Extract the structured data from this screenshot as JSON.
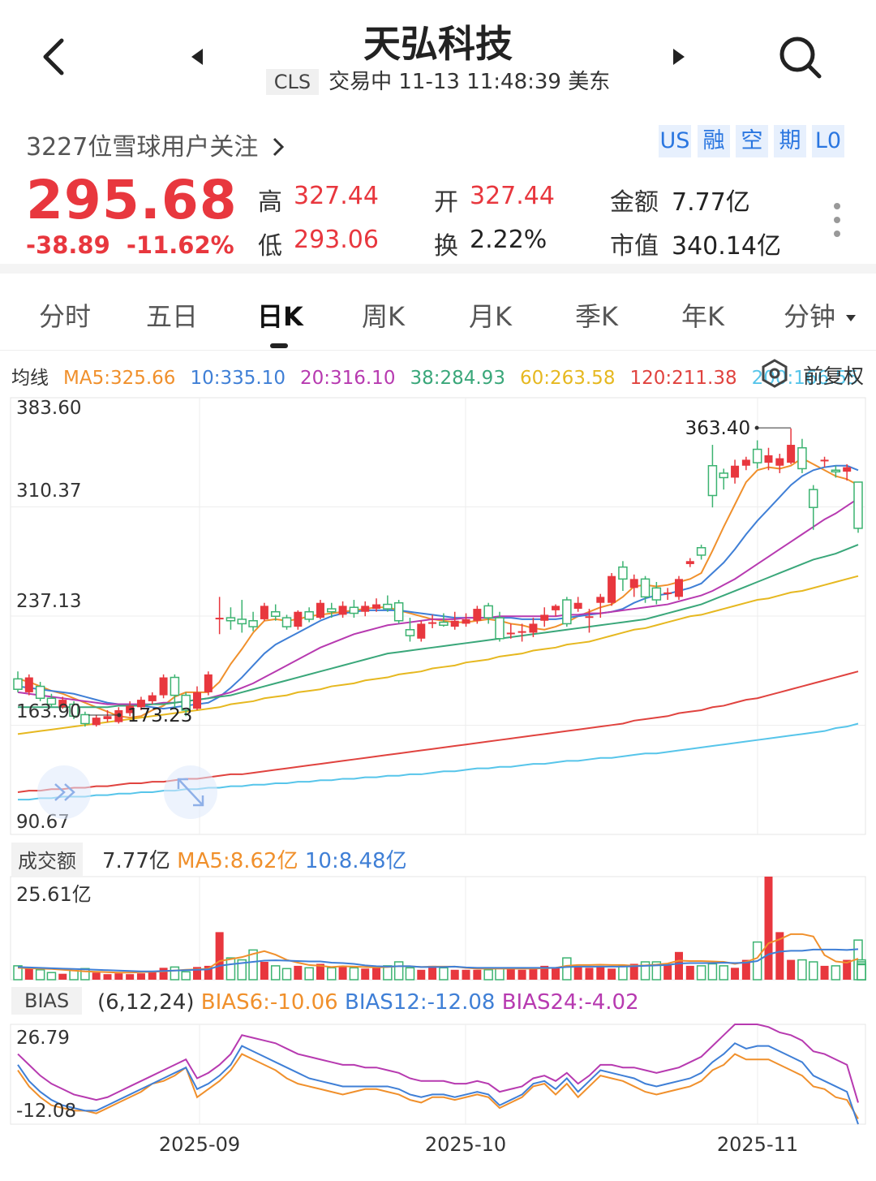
{
  "header": {
    "title": "天弘科技",
    "exchange_badge": "CLS",
    "status_text": "交易中 11-13 11:48:39 美东"
  },
  "info": {
    "followers": "3227位雪球用户关注",
    "flags": [
      "US",
      "融",
      "空",
      "期",
      "L0"
    ],
    "price": "295.68",
    "change": "-38.89",
    "change_pct": "-11.62%",
    "stats": {
      "high_label": "高",
      "high": "327.44",
      "low_label": "低",
      "low": "293.06",
      "open_label": "开",
      "open": "327.44",
      "turnover_label": "换",
      "turnover": "2.22%",
      "amount_label": "金额",
      "amount": "7.77亿",
      "mktcap_label": "市值",
      "mktcap": "340.14亿"
    }
  },
  "tabs": [
    "分时",
    "五日",
    "日K",
    "周K",
    "月K",
    "季K",
    "年K",
    "分钟"
  ],
  "active_tab": "日K",
  "ma_legend": {
    "label": "均线",
    "items": [
      {
        "text": "MA5:325.66",
        "color": "#f0902c"
      },
      {
        "text": "10:335.10",
        "color": "#3f7fd6"
      },
      {
        "text": "20:316.10",
        "color": "#b73ab0"
      },
      {
        "text": "38:284.93",
        "color": "#3aa77a"
      },
      {
        "text": "60:263.58",
        "color": "#e6b820"
      },
      {
        "text": "120:211.38",
        "color": "#e0433f"
      },
      {
        "text": "200:166.55",
        "color": "#57c5ea"
      }
    ],
    "adjust": "前复权"
  },
  "price_axis": [
    "383.60",
    "310.37",
    "237.13",
    "163.90",
    "90.67"
  ],
  "annotations": {
    "high_mark": "363.40",
    "low_mark": "173.23"
  },
  "date_axis": [
    "2025-09",
    "2025-10",
    "2025-11"
  ],
  "volume": {
    "tag": "成交额",
    "value": "7.77亿",
    "ma5": "MA5:8.62亿",
    "ma10": "10:8.48亿",
    "axis_max": "25.61亿"
  },
  "bias": {
    "tag": "BIAS",
    "params": "(6,12,24)",
    "b6": "BIAS6:-10.06",
    "b12": "BIAS12:-12.08",
    "b24": "BIAS24:-4.02",
    "axis_max": "26.79",
    "axis_min": "-12.08"
  },
  "colors": {
    "up": "#e8373e",
    "down": "#3cb371",
    "accent": "#2a76e0"
  },
  "chart_data": {
    "type": "candlestick",
    "ylim": [
      90.67,
      383.6
    ],
    "candles": [
      [
        195,
        188,
        200,
        186
      ],
      [
        186,
        196,
        198,
        184
      ],
      [
        190,
        182,
        193,
        180
      ],
      [
        182,
        178,
        185,
        176
      ],
      [
        176,
        181,
        183,
        175
      ],
      [
        178,
        170,
        180,
        168
      ],
      [
        171,
        165,
        173,
        163
      ],
      [
        164,
        169,
        171,
        163
      ],
      [
        168,
        170,
        174,
        166
      ],
      [
        166,
        174,
        176,
        165
      ],
      [
        172,
        177,
        180,
        170
      ],
      [
        176,
        181,
        183,
        174
      ],
      [
        180,
        184,
        186,
        178
      ],
      [
        184,
        196,
        198,
        182
      ],
      [
        196,
        184,
        198,
        175
      ],
      [
        184,
        174,
        186,
        170
      ],
      [
        175,
        186,
        190,
        174
      ],
      [
        186,
        198,
        200,
        184
      ],
      [
        235,
        236,
        250,
        225
      ],
      [
        236,
        234,
        243,
        228
      ],
      [
        235,
        232,
        248,
        226
      ],
      [
        234,
        230,
        240,
        227
      ],
      [
        235,
        244,
        246,
        234
      ],
      [
        240,
        237,
        245,
        234
      ],
      [
        236,
        230,
        238,
        228
      ],
      [
        230,
        240,
        241,
        228
      ],
      [
        240,
        235,
        243,
        233
      ],
      [
        236,
        246,
        248,
        235
      ],
      [
        242,
        240,
        246,
        236
      ],
      [
        238,
        244,
        247,
        236
      ],
      [
        243,
        239,
        248,
        236
      ],
      [
        240,
        244,
        247,
        237
      ],
      [
        242,
        245,
        249,
        240
      ],
      [
        245,
        242,
        251,
        240
      ],
      [
        246,
        234,
        248,
        232
      ],
      [
        228,
        224,
        236,
        220
      ],
      [
        222,
        232,
        234,
        220
      ],
      [
        232,
        233,
        238,
        229
      ],
      [
        233,
        231,
        239,
        230
      ],
      [
        230,
        234,
        240,
        228
      ],
      [
        232,
        235,
        239,
        230
      ],
      [
        234,
        242,
        244,
        232
      ],
      [
        244,
        236,
        246,
        232
      ],
      [
        236,
        222,
        240,
        220
      ],
      [
        225,
        226,
        232,
        222
      ],
      [
        226,
        227,
        232,
        220
      ],
      [
        226,
        232,
        236,
        223
      ],
      [
        234,
        238,
        243,
        230
      ],
      [
        241,
        244,
        245,
        237
      ],
      [
        248,
        232,
        250,
        230
      ],
      [
        242,
        246,
        250,
        240
      ],
      [
        236,
        237,
        242,
        226
      ],
      [
        246,
        250,
        252,
        236
      ],
      [
        246,
        264,
        266,
        244
      ],
      [
        270,
        262,
        274,
        254
      ],
      [
        256,
        262,
        265,
        250
      ],
      [
        262,
        250,
        264,
        246
      ],
      [
        256,
        248,
        260,
        245
      ],
      [
        252,
        253,
        256,
        248
      ],
      [
        250,
        262,
        264,
        248
      ],
      [
        272,
        274,
        276,
        270
      ],
      [
        283,
        278,
        285,
        275
      ],
      [
        338,
        318,
        352,
        310
      ],
      [
        333,
        330,
        336,
        322
      ],
      [
        330,
        338,
        342,
        326
      ],
      [
        338,
        342,
        344,
        335
      ],
      [
        349,
        340,
        355,
        336
      ],
      [
        340,
        345,
        350,
        335
      ],
      [
        338,
        343,
        346,
        333
      ],
      [
        340,
        352,
        363,
        339
      ],
      [
        350,
        336,
        356,
        333
      ],
      [
        322,
        310,
        325,
        295
      ],
      [
        341,
        342,
        344,
        337
      ],
      [
        335,
        334,
        338,
        330
      ],
      [
        334,
        337,
        339,
        328
      ],
      [
        327,
        296,
        327,
        293
      ]
    ],
    "ma": {
      "MA5": [
        195,
        193,
        190,
        187,
        185,
        182,
        179,
        176,
        173,
        170,
        169,
        170,
        174,
        177,
        183,
        186,
        186,
        186,
        193,
        205,
        215,
        226,
        234,
        235,
        234,
        235,
        237,
        238,
        239,
        240,
        241,
        242,
        243,
        243,
        241,
        239,
        237,
        235,
        234,
        233,
        233,
        234,
        235,
        234,
        232,
        231,
        229,
        228,
        230,
        233,
        237,
        240,
        243,
        245,
        250,
        257,
        258,
        257,
        258,
        260,
        262,
        266,
        281,
        297,
        312,
        327,
        335,
        337,
        336,
        338,
        343,
        339,
        335,
        331,
        329,
        325
      ],
      "MA10": [
        190,
        189,
        188,
        187,
        186,
        185,
        183,
        181,
        179,
        178,
        178,
        177,
        176,
        175,
        176,
        177,
        178,
        179,
        183,
        189,
        196,
        204,
        212,
        218,
        222,
        226,
        230,
        234,
        237,
        239,
        240,
        241,
        241,
        241,
        241,
        240,
        239,
        238,
        237,
        236,
        236,
        236,
        236,
        236,
        236,
        235,
        235,
        235,
        235,
        236,
        237,
        238,
        239,
        240,
        242,
        246,
        249,
        251,
        252,
        254,
        256,
        259,
        266,
        273,
        282,
        292,
        301,
        309,
        317,
        325,
        331,
        335,
        337,
        338,
        338,
        335
      ],
      "MA20": [
        186,
        185,
        184,
        183,
        182,
        181,
        180,
        179,
        178,
        178,
        178,
        178,
        178,
        179,
        179,
        180,
        181,
        182,
        184,
        186,
        189,
        192,
        196,
        200,
        204,
        208,
        212,
        216,
        219,
        222,
        225,
        227,
        229,
        231,
        232,
        233,
        234,
        235,
        235,
        235,
        236,
        236,
        236,
        237,
        237,
        237,
        237,
        237,
        237,
        238,
        238,
        239,
        239,
        240,
        241,
        242,
        243,
        244,
        245,
        247,
        249,
        251,
        254,
        258,
        262,
        267,
        272,
        277,
        282,
        287,
        292,
        297,
        302,
        306,
        311,
        316
      ],
      "MA38": [
        176,
        176,
        176,
        176,
        176,
        176,
        176,
        176,
        176,
        177,
        177,
        177,
        178,
        178,
        179,
        180,
        181,
        182,
        183,
        184,
        186,
        188,
        190,
        192,
        194,
        196,
        198,
        200,
        202,
        204,
        206,
        208,
        210,
        212,
        213,
        214,
        215,
        216,
        217,
        218,
        219,
        220,
        221,
        222,
        223,
        224,
        225,
        226,
        227,
        228,
        229,
        230,
        231,
        232,
        233,
        234,
        235,
        237,
        239,
        241,
        243,
        245,
        248,
        251,
        254,
        257,
        260,
        263,
        266,
        269,
        272,
        275,
        277,
        279,
        282,
        285
      ],
      "MA60": [
        158,
        159,
        160,
        161,
        162,
        163,
        164,
        165,
        166,
        167,
        168,
        169,
        170,
        171,
        172,
        173,
        174,
        175,
        176,
        178,
        179,
        180,
        182,
        183,
        184,
        186,
        187,
        188,
        190,
        191,
        192,
        194,
        195,
        196,
        198,
        199,
        200,
        202,
        203,
        204,
        206,
        207,
        208,
        210,
        211,
        212,
        214,
        215,
        216,
        218,
        219,
        220,
        222,
        224,
        226,
        228,
        229,
        231,
        233,
        235,
        237,
        238,
        240,
        242,
        244,
        246,
        248,
        249,
        251,
        253,
        254,
        256,
        258,
        260,
        262,
        264
      ],
      "MA120": [
        119,
        120,
        120,
        121,
        121,
        122,
        122,
        123,
        123,
        124,
        125,
        125,
        126,
        126,
        127,
        128,
        128,
        129,
        130,
        131,
        131,
        132,
        133,
        134,
        135,
        136,
        137,
        138,
        139,
        140,
        141,
        142,
        143,
        144,
        145,
        146,
        147,
        148,
        149,
        150,
        151,
        152,
        153,
        154,
        155,
        156,
        157,
        158,
        159,
        160,
        161,
        162,
        163,
        164,
        165,
        167,
        168,
        169,
        170,
        172,
        173,
        174,
        176,
        177,
        179,
        181,
        182,
        184,
        186,
        188,
        190,
        192,
        194,
        196,
        198,
        200
      ],
      "MA200": [
        114,
        114,
        115,
        115,
        116,
        116,
        116,
        117,
        117,
        118,
        118,
        119,
        119,
        120,
        120,
        121,
        121,
        122,
        122,
        123,
        123,
        124,
        124,
        125,
        125,
        126,
        126,
        127,
        127,
        128,
        128,
        129,
        129,
        130,
        130,
        131,
        131,
        132,
        133,
        133,
        134,
        135,
        135,
        136,
        136,
        137,
        138,
        138,
        139,
        140,
        140,
        141,
        142,
        142,
        143,
        144,
        145,
        145,
        146,
        147,
        148,
        149,
        150,
        151,
        152,
        153,
        154,
        155,
        156,
        157,
        158,
        159,
        160,
        162,
        163,
        165
      ]
    },
    "volume": [
      3.5,
      3.2,
      2.5,
      1.8,
      1.5,
      2.3,
      2.8,
      1.8,
      1.4,
      1.6,
      1.4,
      1.6,
      2.0,
      3.0,
      3.2,
      2.0,
      3.2,
      3.5,
      12,
      5.5,
      5.0,
      7.5,
      4.5,
      3.5,
      2.8,
      3.5,
      3.0,
      4.0,
      3.0,
      3.5,
      3.0,
      2.8,
      3.0,
      3.5,
      4.5,
      3.0,
      2.5,
      3.5,
      3.0,
      2.5,
      2.5,
      2.5,
      2.5,
      3.0,
      3.0,
      2.5,
      3.0,
      3.5,
      3.0,
      5.5,
      3.5,
      3.0,
      3.5,
      2.8,
      3.5,
      4.0,
      4.5,
      4.5,
      4.0,
      7.0,
      3.5,
      3.5,
      4.0,
      3.5,
      3.0,
      5.0,
      9.5,
      26,
      12,
      5.0,
      5.0,
      4.5,
      3.5,
      3.5,
      5.0,
      10,
      5.0,
      4.5,
      4.0,
      3.5,
      3.8
    ],
    "volume_ma5": [
      3.0,
      2.9,
      2.8,
      2.7,
      2.5,
      2.3,
      2.1,
      2.0,
      1.9,
      1.8,
      1.8,
      1.9,
      2.0,
      2.1,
      2.3,
      2.5,
      2.6,
      2.8,
      4.7,
      5.2,
      5.7,
      6.5,
      7.2,
      6.3,
      5.0,
      4.3,
      3.7,
      3.5,
      3.2,
      3.4,
      3.3,
      3.2,
      3.1,
      3.2,
      3.4,
      3.4,
      3.2,
      3.3,
      3.3,
      3.3,
      3.0,
      2.8,
      2.8,
      2.8,
      2.8,
      2.8,
      2.8,
      2.9,
      3.0,
      3.5,
      3.7,
      3.7,
      3.8,
      3.7,
      3.7,
      3.5,
      3.6,
      3.8,
      4.1,
      4.8,
      4.7,
      4.7,
      4.6,
      4.5,
      4.0,
      4.5,
      5.5,
      9.2,
      10.2,
      11.5,
      11.5,
      10.9,
      6.2,
      4.6,
      4.3,
      5.3,
      5.4,
      5.6,
      5.5,
      5.7,
      5.5
    ],
    "volume_ma10": [
      3.2,
      3.1,
      3.0,
      2.9,
      2.8,
      2.7,
      2.6,
      2.5,
      2.4,
      2.3,
      2.2,
      2.1,
      2.1,
      2.2,
      2.3,
      2.4,
      2.5,
      2.6,
      3.5,
      3.9,
      4.2,
      4.5,
      4.8,
      4.9,
      4.8,
      4.7,
      4.6,
      4.6,
      4.3,
      4.2,
      4.0,
      3.6,
      3.4,
      3.3,
      3.4,
      3.4,
      3.2,
      3.2,
      3.2,
      3.3,
      3.1,
      3.0,
      3.0,
      3.0,
      3.0,
      3.0,
      3.0,
      3.0,
      3.0,
      3.2,
      3.3,
      3.3,
      3.3,
      3.3,
      3.3,
      3.4,
      3.5,
      3.6,
      3.7,
      4.1,
      4.2,
      4.2,
      4.2,
      4.3,
      4.2,
      4.3,
      4.7,
      6.4,
      7.1,
      7.3,
      7.3,
      7.6,
      7.6,
      7.6,
      7.5,
      7.7,
      7.2,
      6.6,
      6.0,
      5.8,
      5.7
    ],
    "bias6": [
      8,
      2,
      -2,
      -5,
      -6,
      -7,
      -7,
      -8,
      -6,
      -4,
      -2,
      0,
      3,
      4,
      6,
      9,
      -2,
      1,
      4,
      8,
      14,
      12,
      10,
      8,
      5,
      3,
      2,
      1,
      0,
      -1,
      0,
      1,
      1,
      0,
      -1,
      -3,
      -4,
      -2,
      -2,
      -3,
      -2,
      -1,
      -2,
      -6,
      -4,
      -2,
      2,
      3,
      -1,
      3,
      -2,
      2,
      6,
      5,
      4,
      2,
      0,
      -1,
      0,
      1,
      2,
      4,
      8,
      10,
      14,
      12,
      12,
      12,
      10,
      8,
      6,
      2,
      1,
      -2,
      -3,
      -10
    ],
    "bias12": [
      10,
      4,
      0,
      -3,
      -5,
      -6,
      -7,
      -7,
      -5,
      -3,
      -1,
      1,
      3,
      5,
      7,
      9,
      1,
      3,
      6,
      10,
      17,
      15,
      13,
      11,
      9,
      7,
      5,
      4,
      3,
      2,
      2,
      2,
      2,
      2,
      1,
      -1,
      -2,
      -1,
      -1,
      -2,
      -1,
      0,
      -1,
      -5,
      -3,
      -1,
      3,
      4,
      1,
      5,
      0,
      4,
      8,
      7,
      6,
      5,
      3,
      2,
      3,
      4,
      5,
      7,
      11,
      14,
      18,
      16,
      17,
      17,
      15,
      13,
      11,
      6,
      4,
      2,
      0,
      -12
    ],
    "bias24": [
      14,
      10,
      6,
      3,
      1,
      -1,
      -2,
      -3,
      -2,
      0,
      2,
      4,
      6,
      8,
      10,
      12,
      5,
      7,
      10,
      14,
      21,
      20,
      19,
      18,
      16,
      14,
      13,
      12,
      11,
      10,
      10,
      9,
      9,
      8,
      7,
      5,
      4,
      4,
      4,
      3,
      3,
      4,
      3,
      0,
      1,
      2,
      5,
      6,
      4,
      7,
      3,
      6,
      10,
      10,
      9,
      9,
      8,
      7,
      8,
      9,
      11,
      13,
      17,
      21,
      25,
      25,
      25,
      24,
      22,
      21,
      19,
      15,
      14,
      12,
      10,
      -4
    ]
  }
}
